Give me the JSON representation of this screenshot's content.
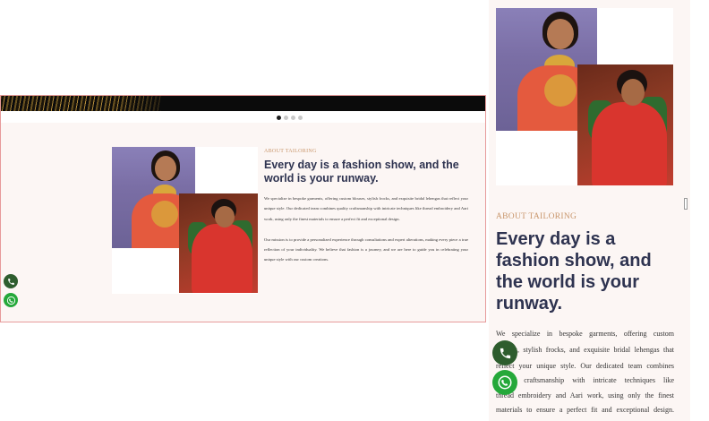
{
  "slider": {
    "dots": [
      {
        "active": true
      },
      {
        "active": false
      },
      {
        "active": false
      },
      {
        "active": false
      }
    ]
  },
  "about": {
    "eyebrow": "ABOUT TAILORING",
    "heading": "Every day is a fashion show, and the world is your runway.",
    "paragraph1": "We specialize in bespoke garments, offering custom blouses, stylish frocks, and exquisite bridal lehengas that reflect your unique style. Our dedicated team combines quality craftsmanship with intricate techniques like thread embroidery and Aari work, using only the finest materials to ensure a perfect fit and exceptional design.",
    "paragraph2": "Our mission is to provide a personalized experience through consultations and expert alterations, making every piece a true reflection of your individuality. We believe that fashion is a journey, and we are here to guide you in celebrating your unique style with our custom creations."
  },
  "mobile": {
    "eyebrow": "ABOUT TAILORING",
    "heading": "Every day is a fashion show, and the world is your runway.",
    "paragraph_line1": "We specialize in bespoke garments, offering custom",
    "paragraph_line2": "blouses, stylish frocks, and exquisite bridal lehengas that",
    "paragraph_line3": "reflect your unique style. Our dedicated team combines",
    "paragraph_line4": "quality craftsmanship with intricate techniques like",
    "paragraph_line5": "thread embroidery and Aari work, using only the finest",
    "paragraph_line6": "materials to ensure a perfect fit and exceptional design."
  },
  "icons": {
    "phone": "phone-icon",
    "whatsapp": "whatsapp-icon"
  },
  "colors": {
    "accent_gold": "#c8956a",
    "heading_navy": "#2e3350",
    "phone_green": "#2e5d2e",
    "whatsapp_green": "#25a83a"
  }
}
